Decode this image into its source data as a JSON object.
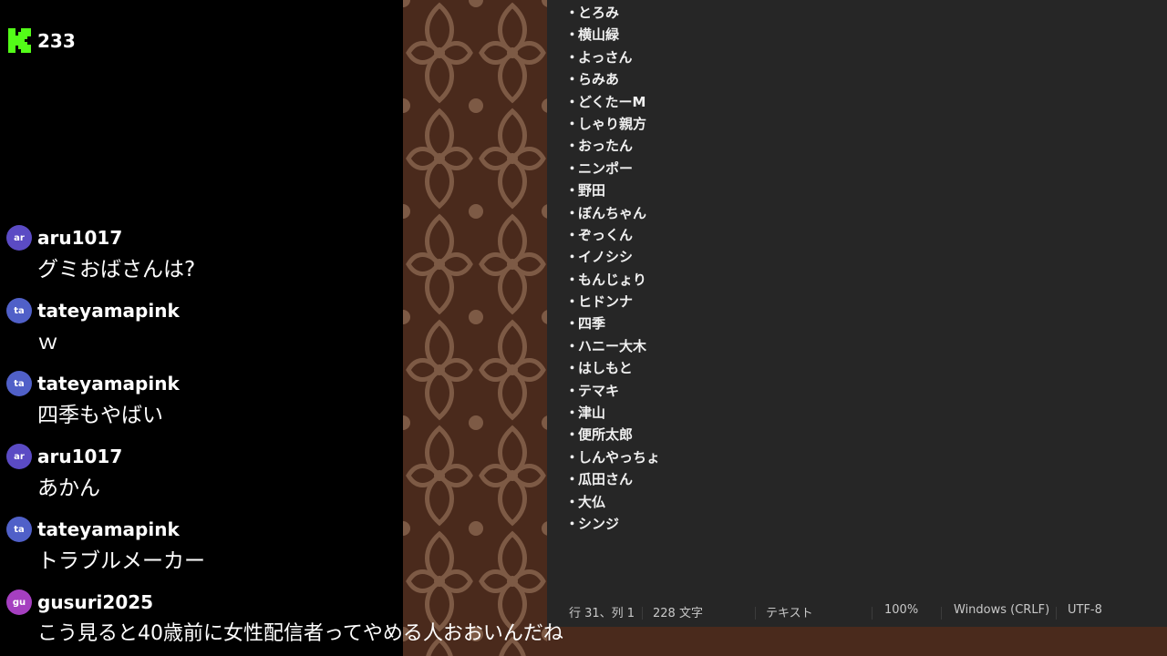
{
  "header": {
    "viewer_count": "233",
    "brand_color": "#53fc18"
  },
  "chat": [
    {
      "initials": "ar",
      "user": "aru1017",
      "text": "グミおばさんは?",
      "color": "#5b4bc4"
    },
    {
      "initials": "ta",
      "user": "tateyamapink",
      "text": "ｗ",
      "color": "#5060c8"
    },
    {
      "initials": "ta",
      "user": "tateyamapink",
      "text": "四季もやばい",
      "color": "#5060c8"
    },
    {
      "initials": "ar",
      "user": "aru1017",
      "text": "あかん",
      "color": "#5b4bc4"
    },
    {
      "initials": "ta",
      "user": "tateyamapink",
      "text": "トラブルメーカー",
      "color": "#5060c8"
    },
    {
      "initials": "gu",
      "user": "gusuri2025",
      "text": "こう見ると40歳前に女性配信者ってやめる人おおいんだね",
      "color": "#a53fc0"
    }
  ],
  "editor": {
    "bullet": "・",
    "items": [
      "とろみ",
      "横山緑",
      "よっさん",
      "らみあ",
      "どくたーM",
      "しゃり親方",
      "おったん",
      "ニンポー",
      "野田",
      "ぼんちゃん",
      "ぞっくん",
      "イノシシ",
      "もんじょり",
      "ヒドンナ",
      "四季",
      "ハニー大木",
      "はしもと",
      "テマキ",
      "津山",
      "便所太郎",
      "しんやっちょ",
      "瓜田さん",
      "大仏",
      "シンジ"
    ]
  },
  "statusbar": {
    "position": "行 31、列 1",
    "chars": "228 文字",
    "format": "テキスト",
    "zoom": "100%",
    "line_ending": "Windows (CRLF)",
    "encoding": "UTF-8"
  }
}
